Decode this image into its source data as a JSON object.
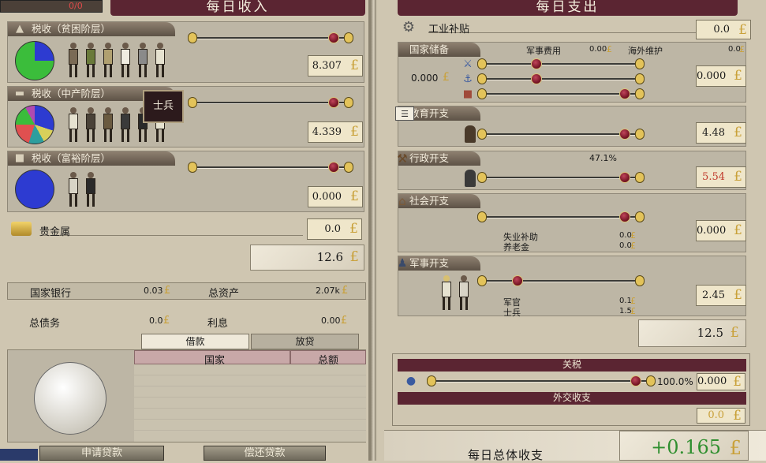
{
  "left": {
    "header": "每日收入",
    "top_counter": "0/0",
    "tax_poor": {
      "label": "税收（贫困阶层）",
      "value": "8.307"
    },
    "tax_middle": {
      "label": "税收（中产阶层）",
      "value": "4.339"
    },
    "tax_rich": {
      "label": "税收（富裕阶层）",
      "value": "0.000"
    },
    "tooltip": "士兵",
    "gold": {
      "label": "贵金属",
      "value": "0.0"
    },
    "total_income": "12.6",
    "bank": {
      "label": "国家银行",
      "value": "0.03"
    },
    "assets": {
      "label": "总资产",
      "value": "2.07k"
    },
    "debt": {
      "label": "总债务",
      "value": "0.0"
    },
    "interest": {
      "label": "利息",
      "value": "0.00"
    },
    "tabs": [
      "借款",
      "放贷"
    ],
    "loan_table": {
      "columns": [
        "国家",
        "总额"
      ]
    },
    "buttons": {
      "apply": "申请贷款",
      "repay": "偿还贷款"
    }
  },
  "right": {
    "header": "每日支出",
    "industry": {
      "label": "工业补贴",
      "value": "0.0"
    },
    "reserve": {
      "label": "国家储备",
      "military_fee_label": "军事费用",
      "military_fee_value": "0.00",
      "overseas_label": "海外维护",
      "overseas_value": "0.0",
      "left_value": "0.000",
      "value": "0.000"
    },
    "education": {
      "label": "教育开支",
      "value": "4.48"
    },
    "admin": {
      "label": "行政开支",
      "percent": "47.1%",
      "value": "5.54"
    },
    "social": {
      "label": "社会开支",
      "unemployment_label": "失业补助",
      "unemployment_value": "0.0",
      "pension_label": "养老金",
      "pension_value": "0.0",
      "value": "0.000"
    },
    "military": {
      "label": "军事开支",
      "officers_label": "军官",
      "officers_value": "0.1",
      "soldiers_label": "士兵",
      "soldiers_value": "1.5",
      "value": "2.45"
    },
    "total_expense": "12.5",
    "tariff": {
      "label": "关税",
      "percent": "100.0%",
      "value": "0.000"
    },
    "diplomacy": {
      "label": "外交收支",
      "value": "0.0"
    },
    "daily_total": {
      "label": "每日总体收支",
      "value": "+0.165"
    }
  },
  "colors": {
    "maroon": "#5b2532",
    "gold": "#c9a13a",
    "red_value": "#c0392b",
    "green_total": "#2f8f2f"
  },
  "pound_symbol": "£"
}
